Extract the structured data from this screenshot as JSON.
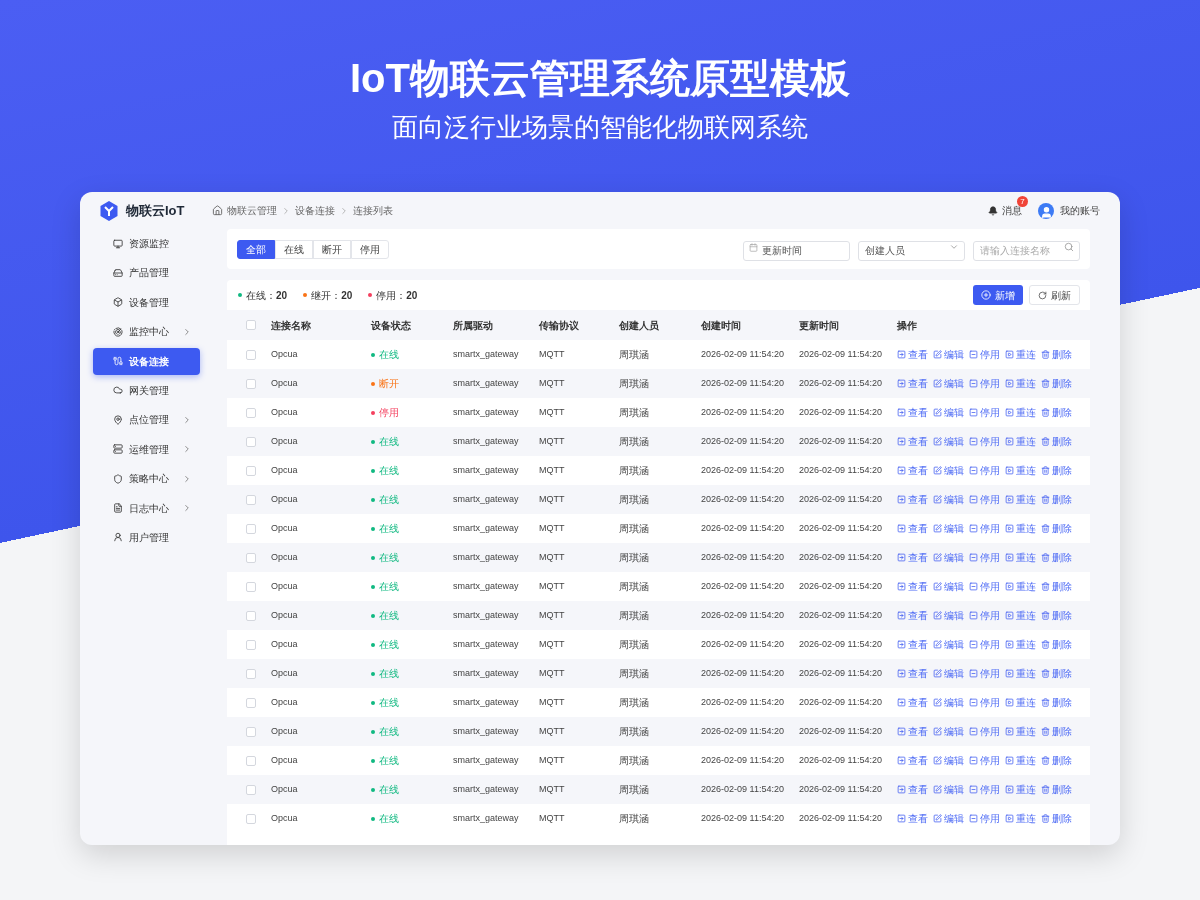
{
  "banner": {
    "title": "IoT物联云管理系统原型模板",
    "subtitle": "面向泛行业场景的智能化物联网系统"
  },
  "header": {
    "logo": "物联云IoT",
    "breadcrumb": [
      "物联云管理",
      "设备连接",
      "连接列表"
    ],
    "messages": {
      "label": "消息",
      "badge": "7"
    },
    "account": "我的账号"
  },
  "sidebar": {
    "items": [
      {
        "label": "资源监控",
        "selected": false,
        "has_submenu": false
      },
      {
        "label": "产品管理",
        "selected": false,
        "has_submenu": false
      },
      {
        "label": "设备管理",
        "selected": false,
        "has_submenu": false
      },
      {
        "label": "监控中心",
        "selected": false,
        "has_submenu": true
      },
      {
        "label": "设备连接",
        "selected": true,
        "has_submenu": false
      },
      {
        "label": "网关管理",
        "selected": false,
        "has_submenu": false
      },
      {
        "label": "点位管理",
        "selected": false,
        "has_submenu": true
      },
      {
        "label": "运维管理",
        "selected": false,
        "has_submenu": true
      },
      {
        "label": "策略中心",
        "selected": false,
        "has_submenu": true
      },
      {
        "label": "日志中心",
        "selected": false,
        "has_submenu": true
      },
      {
        "label": "用户管理",
        "selected": false,
        "has_submenu": false
      }
    ]
  },
  "filters": {
    "tabs": [
      {
        "label": "全部",
        "selected": true
      },
      {
        "label": "在线",
        "selected": false
      },
      {
        "label": "断开",
        "selected": false
      },
      {
        "label": "停用",
        "selected": false
      }
    ],
    "date": {
      "placeholder": "更新时间"
    },
    "creator": {
      "placeholder": "创建人员"
    },
    "search": {
      "placeholder": "请输入连接名称"
    }
  },
  "stats": [
    {
      "label": "在线：",
      "count": "20",
      "color": "#10b981"
    },
    {
      "label": "继开：",
      "count": "20",
      "color": "#f97316"
    },
    {
      "label": "停用：",
      "count": "20",
      "color": "#f43f5e"
    }
  ],
  "buttons": {
    "add": "新增",
    "refresh": "刷新"
  },
  "table": {
    "header_checked": false,
    "columns": [
      "连接名称",
      "设备状态",
      "所属驱动",
      "传输协议",
      "创建人员",
      "创建时间",
      "更新时间",
      "操作"
    ],
    "rows": [
      {
        "checked": false,
        "name": "Opcua",
        "status": "在线",
        "color": "#10b981",
        "driver": "smartx_gateway",
        "protocol": "MQTT",
        "creator": "周琪涵",
        "created": "2026-02-09 11:54:20",
        "updated": "2026-02-09 11:54:20",
        "actions": [
          "查看",
          "编辑",
          "停用",
          "重连",
          "删除"
        ]
      },
      {
        "checked": false,
        "name": "Opcua",
        "status": "断开",
        "color": "#f97316",
        "driver": "smartx_gateway",
        "protocol": "MQTT",
        "creator": "周琪涵",
        "created": "2026-02-09 11:54:20",
        "updated": "2026-02-09 11:54:20",
        "actions": [
          "查看",
          "编辑",
          "停用",
          "重连",
          "删除"
        ]
      },
      {
        "checked": false,
        "name": "Opcua",
        "status": "停用",
        "color": "#f43f5e",
        "driver": "smartx_gateway",
        "protocol": "MQTT",
        "creator": "周琪涵",
        "created": "2026-02-09 11:54:20",
        "updated": "2026-02-09 11:54:20",
        "actions": [
          "查看",
          "编辑",
          "停用",
          "重连",
          "删除"
        ]
      },
      {
        "checked": false,
        "name": "Opcua",
        "status": "在线",
        "color": "#10b981",
        "driver": "smartx_gateway",
        "protocol": "MQTT",
        "creator": "周琪涵",
        "created": "2026-02-09 11:54:20",
        "updated": "2026-02-09 11:54:20",
        "actions": [
          "查看",
          "编辑",
          "停用",
          "重连",
          "删除"
        ]
      },
      {
        "checked": false,
        "name": "Opcua",
        "status": "在线",
        "color": "#10b981",
        "driver": "smartx_gateway",
        "protocol": "MQTT",
        "creator": "周琪涵",
        "created": "2026-02-09 11:54:20",
        "updated": "2026-02-09 11:54:20",
        "actions": [
          "查看",
          "编辑",
          "停用",
          "重连",
          "删除"
        ]
      },
      {
        "checked": false,
        "name": "Opcua",
        "status": "在线",
        "color": "#10b981",
        "driver": "smartx_gateway",
        "protocol": "MQTT",
        "creator": "周琪涵",
        "created": "2026-02-09 11:54:20",
        "updated": "2026-02-09 11:54:20",
        "actions": [
          "查看",
          "编辑",
          "停用",
          "重连",
          "删除"
        ]
      },
      {
        "checked": false,
        "name": "Opcua",
        "status": "在线",
        "color": "#10b981",
        "driver": "smartx_gateway",
        "protocol": "MQTT",
        "creator": "周琪涵",
        "created": "2026-02-09 11:54:20",
        "updated": "2026-02-09 11:54:20",
        "actions": [
          "查看",
          "编辑",
          "停用",
          "重连",
          "删除"
        ]
      },
      {
        "checked": false,
        "name": "Opcua",
        "status": "在线",
        "color": "#10b981",
        "driver": "smartx_gateway",
        "protocol": "MQTT",
        "creator": "周琪涵",
        "created": "2026-02-09 11:54:20",
        "updated": "2026-02-09 11:54:20",
        "actions": [
          "查看",
          "编辑",
          "停用",
          "重连",
          "删除"
        ]
      },
      {
        "checked": false,
        "name": "Opcua",
        "status": "在线",
        "color": "#10b981",
        "driver": "smartx_gateway",
        "protocol": "MQTT",
        "creator": "周琪涵",
        "created": "2026-02-09 11:54:20",
        "updated": "2026-02-09 11:54:20",
        "actions": [
          "查看",
          "编辑",
          "停用",
          "重连",
          "删除"
        ]
      },
      {
        "checked": false,
        "name": "Opcua",
        "status": "在线",
        "color": "#10b981",
        "driver": "smartx_gateway",
        "protocol": "MQTT",
        "creator": "周琪涵",
        "created": "2026-02-09 11:54:20",
        "updated": "2026-02-09 11:54:20",
        "actions": [
          "查看",
          "编辑",
          "停用",
          "重连",
          "删除"
        ]
      },
      {
        "checked": false,
        "name": "Opcua",
        "status": "在线",
        "color": "#10b981",
        "driver": "smartx_gateway",
        "protocol": "MQTT",
        "creator": "周琪涵",
        "created": "2026-02-09 11:54:20",
        "updated": "2026-02-09 11:54:20",
        "actions": [
          "查看",
          "编辑",
          "停用",
          "重连",
          "删除"
        ]
      },
      {
        "checked": false,
        "name": "Opcua",
        "status": "在线",
        "color": "#10b981",
        "driver": "smartx_gateway",
        "protocol": "MQTT",
        "creator": "周琪涵",
        "created": "2026-02-09 11:54:20",
        "updated": "2026-02-09 11:54:20",
        "actions": [
          "查看",
          "编辑",
          "停用",
          "重连",
          "删除"
        ]
      },
      {
        "checked": false,
        "name": "Opcua",
        "status": "在线",
        "color": "#10b981",
        "driver": "smartx_gateway",
        "protocol": "MQTT",
        "creator": "周琪涵",
        "created": "2026-02-09 11:54:20",
        "updated": "2026-02-09 11:54:20",
        "actions": [
          "查看",
          "编辑",
          "停用",
          "重连",
          "删除"
        ]
      },
      {
        "checked": false,
        "name": "Opcua",
        "status": "在线",
        "color": "#10b981",
        "driver": "smartx_gateway",
        "protocol": "MQTT",
        "creator": "周琪涵",
        "created": "2026-02-09 11:54:20",
        "updated": "2026-02-09 11:54:20",
        "actions": [
          "查看",
          "编辑",
          "停用",
          "重连",
          "删除"
        ]
      },
      {
        "checked": false,
        "name": "Opcua",
        "status": "在线",
        "color": "#10b981",
        "driver": "smartx_gateway",
        "protocol": "MQTT",
        "creator": "周琪涵",
        "created": "2026-02-09 11:54:20",
        "updated": "2026-02-09 11:54:20",
        "actions": [
          "查看",
          "编辑",
          "停用",
          "重连",
          "删除"
        ]
      },
      {
        "checked": false,
        "name": "Opcua",
        "status": "在线",
        "color": "#10b981",
        "driver": "smartx_gateway",
        "protocol": "MQTT",
        "creator": "周琪涵",
        "created": "2026-02-09 11:54:20",
        "updated": "2026-02-09 11:54:20",
        "actions": [
          "查看",
          "编辑",
          "停用",
          "重连",
          "删除"
        ]
      },
      {
        "checked": false,
        "name": "Opcua",
        "status": "在线",
        "color": "#10b981",
        "driver": "smartx_gateway",
        "protocol": "MQTT",
        "creator": "周琪涵",
        "created": "2026-02-09 11:54:20",
        "updated": "2026-02-09 11:54:20",
        "actions": [
          "查看",
          "编辑",
          "停用",
          "重连",
          "删除"
        ]
      }
    ]
  }
}
